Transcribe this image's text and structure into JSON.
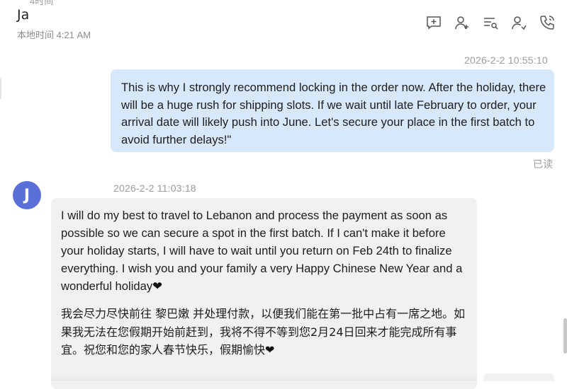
{
  "header": {
    "top_clip": "4时间",
    "contact_name": "Ja",
    "local_time": "本地时间 4:21 AM",
    "toolbar": [
      {
        "name": "add-message-icon"
      },
      {
        "name": "add-contact-icon"
      },
      {
        "name": "list-search-icon"
      },
      {
        "name": "contact-transfer-icon"
      },
      {
        "name": "call-icon"
      }
    ]
  },
  "messages": {
    "outgoing": {
      "timestamp": "2026-2-2 10:55:10",
      "text": "This is why I strongly recommend locking in the order now. After the holiday, there will be a huge rush for shipping slots. If we wait until late February to order, your arrival date will likely push into June. Let's secure your place in the first batch to avoid further delays!\"",
      "status": "已读"
    },
    "incoming": {
      "avatar_letter": "J",
      "timestamp": "2026-2-2 11:03:18",
      "text_en": "I will do my best to travel to Lebanon and process the payment as soon as possible so we can secure a spot in the first batch. If I can't make it before your holiday starts, I will have to wait until you return on Feb 24th to finalize everything. I wish you and your family a very Happy Chinese New Year and a wonderful holiday",
      "text_zh": "我会尽力尽快前往 黎巴嫩 并处理付款，以便我们能在第一批中占有一席之地。如果我无法在您假期开始前赶到，我将不得不等到您2月24日回来才能完成所有事宜。祝您和您的家人春节快乐，假期愉快",
      "heart": "❤"
    }
  },
  "colors": {
    "outgoing_bubble": "#d8e8fb",
    "incoming_bubble": "#f1f1f1",
    "avatar": "#5a6fd8"
  }
}
